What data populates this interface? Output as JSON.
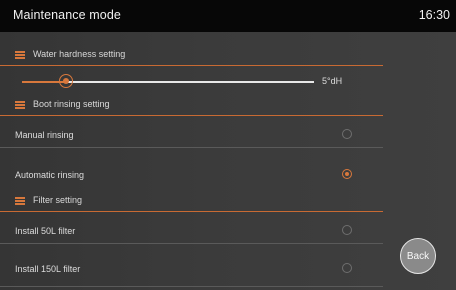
{
  "header": {
    "title": "Maintenance mode",
    "time": "16:30"
  },
  "sections": {
    "water_hardness": {
      "label": "Water hardness setting",
      "slider_value_text": "5°dH",
      "slider_level": 0.15
    },
    "boot_rinsing": {
      "label": "Boot rinsing setting",
      "options": [
        {
          "label": "Manual rinsing",
          "selected": false
        },
        {
          "label": "Automatic rinsing",
          "selected": true
        }
      ]
    },
    "filter": {
      "label": "Filter setting",
      "options": [
        {
          "label": "Install 50L filter",
          "selected": false
        },
        {
          "label": "Install 150L filter",
          "selected": false
        }
      ]
    }
  },
  "back_button": {
    "label": "Back"
  },
  "colors": {
    "accent": "#d8783c",
    "titlebar": "#070707",
    "background": "#3d3d3d"
  },
  "icons": {
    "section_icon": "menu-lines-icon"
  }
}
